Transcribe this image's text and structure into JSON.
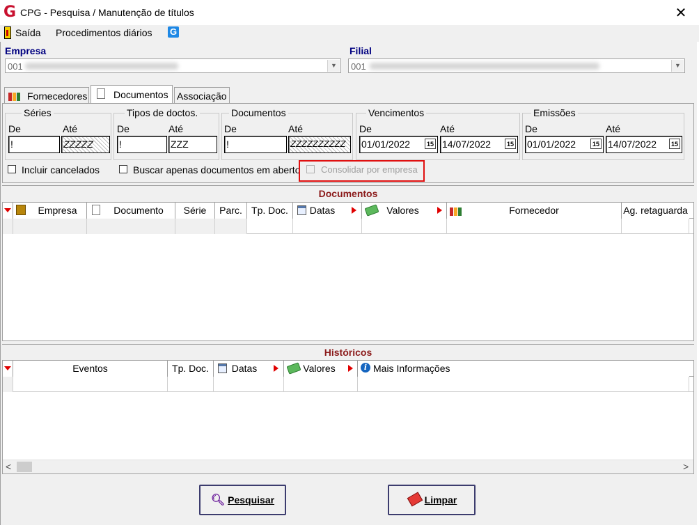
{
  "window": {
    "title": "CPG - Pesquisa / Manutenção de títulos",
    "logo": "G",
    "close": "✕"
  },
  "menu": {
    "items": [
      {
        "label": "Saída"
      },
      {
        "label": "Procedimentos diários"
      }
    ],
    "app_icon": "G"
  },
  "empresa": {
    "label": "Empresa",
    "value": "001"
  },
  "filial": {
    "label": "Filial",
    "value": "001"
  },
  "tabs": [
    {
      "label": "Fornecedores",
      "active": false
    },
    {
      "label": "Documentos",
      "active": true
    },
    {
      "label": "Associação",
      "active": false
    }
  ],
  "filters": {
    "series": {
      "title": "Séries",
      "de_label": "De",
      "ate_label": "Até",
      "de": "!",
      "ate": "ZZZZZ"
    },
    "tipos": {
      "title": "Tipos de doctos.",
      "de_label": "De",
      "ate_label": "Até",
      "de": "!",
      "ate": "ZZZ"
    },
    "documentos": {
      "title": "Documentos",
      "de_label": "De",
      "ate_label": "Até",
      "de": "!",
      "ate": "ZZZZZZZZZZ"
    },
    "vencimentos": {
      "title": "Vencimentos",
      "de_label": "De",
      "ate_label": "Até",
      "de": "01/01/2022",
      "ate": "14/07/2022"
    },
    "emissoes": {
      "title": "Emissões",
      "de_label": "De",
      "ate_label": "Até",
      "de": "01/01/2022",
      "ate": "14/07/2022"
    },
    "cal_label": "15"
  },
  "checks": {
    "incluir_cancelados": "Incluir cancelados",
    "buscar_abertos": "Buscar apenas documentos em aberto",
    "consolidar": "Consolidar por empresa"
  },
  "documentos_grid": {
    "title": "Documentos",
    "columns": [
      "Empresa",
      "Documento",
      "Série",
      "Parc.",
      "Tp. Doc.",
      "Datas",
      "Valores",
      "Fornecedor",
      "Ag. retaguarda"
    ]
  },
  "historicos_grid": {
    "title": "Históricos",
    "columns": [
      "Eventos",
      "Tp. Doc.",
      "Datas",
      "Valores",
      "Mais Informações"
    ]
  },
  "scroll": {
    "left": "<",
    "right": ">"
  },
  "buttons": {
    "pesquisar": "Pesquisar",
    "limpar": "Limpar"
  },
  "colors": {
    "section_title": "#8b1a1a",
    "label_blue": "#000080",
    "highlight": "#e01010"
  }
}
